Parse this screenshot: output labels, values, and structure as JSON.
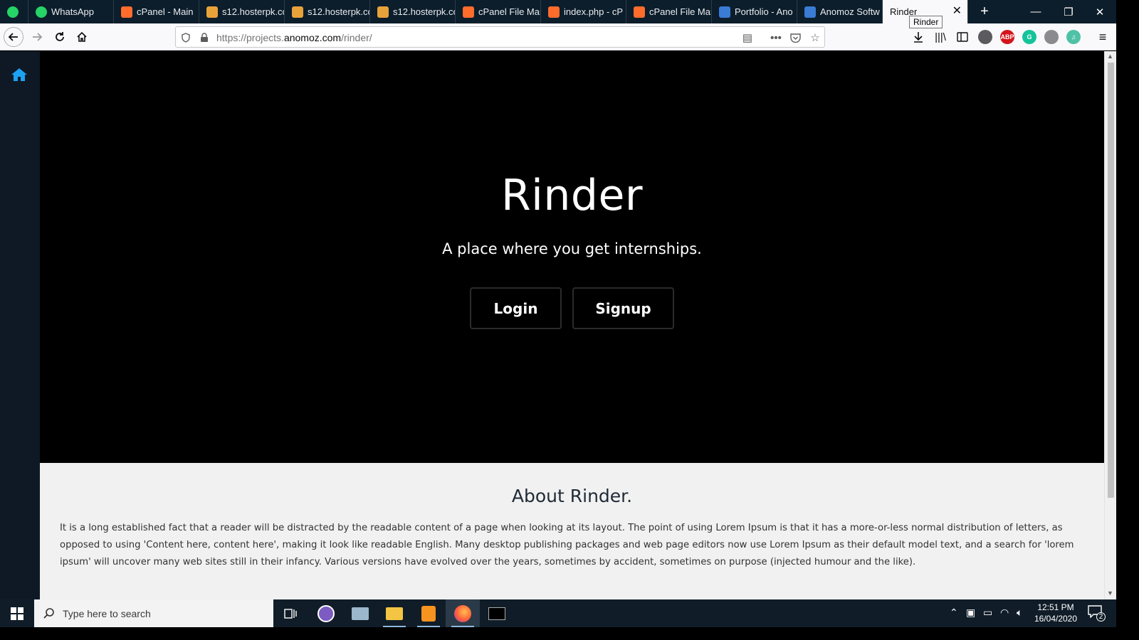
{
  "browser": {
    "tabs": [
      {
        "label": "",
        "icon": "pinned-app-icon",
        "color": "#25d366"
      },
      {
        "label": "WhatsApp",
        "icon": "whatsapp-icon",
        "color": "#25d366"
      },
      {
        "label": "cPanel - Main",
        "icon": "cpanel-icon",
        "color": "#ff6c2c"
      },
      {
        "label": "s12.hosterpk.co",
        "icon": "hosterpk-icon",
        "color": "#e8a23a"
      },
      {
        "label": "s12.hosterpk.co",
        "icon": "hosterpk-icon",
        "color": "#e8a23a"
      },
      {
        "label": "s12.hosterpk.co",
        "icon": "hosterpk-icon",
        "color": "#e8a23a"
      },
      {
        "label": "cPanel File Man",
        "icon": "cpanel-icon",
        "color": "#ff6c2c"
      },
      {
        "label": "index.php - cP",
        "icon": "cpanel-icon",
        "color": "#ff6c2c"
      },
      {
        "label": "cPanel File Man",
        "icon": "cpanel-icon",
        "color": "#ff6c2c"
      },
      {
        "label": "Portfolio - Ano",
        "icon": "anomoz-icon",
        "color": "#3a7bd5"
      },
      {
        "label": "Anomoz Softw",
        "icon": "anomoz-icon",
        "color": "#3a7bd5"
      },
      {
        "label": "Rinder",
        "icon": "none",
        "color": "#f9f9fb"
      }
    ],
    "tooltip": "Rinder",
    "url_prefix": "https://projects.",
    "url_host": "anomoz.com",
    "url_path": "/rinder/"
  },
  "page": {
    "hero": {
      "title": "Rinder",
      "subtitle": "A place where you get internships.",
      "login_label": "Login",
      "signup_label": "Signup"
    },
    "about": {
      "title": "About Rinder.",
      "text": "It is a long established fact that a reader will be distracted by the readable content of a page when looking at its layout. The point of using Lorem Ipsum is that it has a more-or-less normal distribution of letters, as opposed to using 'Content here, content here', making it look like readable English. Many desktop publishing packages and web page editors now use Lorem Ipsum as their default model text, and a search for 'lorem ipsum' will uncover many web sites still in their infancy. Various versions have evolved over the years, sometimes by accident, sometimes on purpose (injected humour and the like)."
    },
    "accent_color": "#1da1f2"
  },
  "taskbar": {
    "search_placeholder": "Type here to search",
    "time": "12:51 PM",
    "date": "16/04/2020",
    "notification_count": "2"
  }
}
